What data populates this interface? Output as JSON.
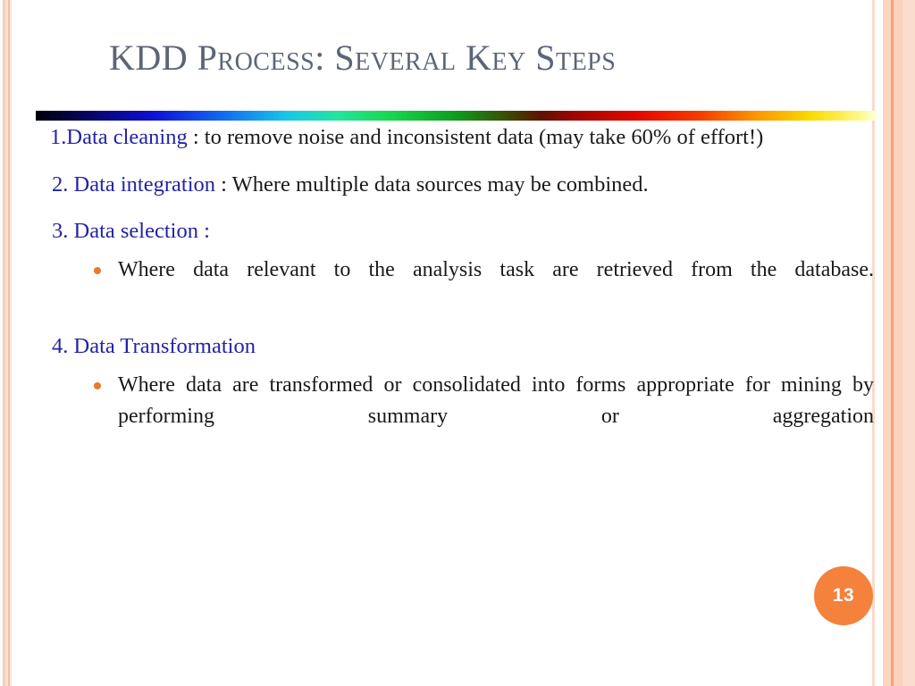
{
  "slide": {
    "title": "KDD Process: Several Key Steps",
    "page_number": "13",
    "colors": {
      "title": "#5c6577",
      "lead_blue": "#2323a6",
      "body_text": "#1a1a1a",
      "bullet_orange": "#e8792e",
      "badge_orange": "#f4823c",
      "edge_peach": "#fbd5c0"
    }
  },
  "items": [
    {
      "lead": "1.Data cleaning",
      "rest": " : to remove noise and inconsistent data (may take 60% of effort!)"
    },
    {
      "lead": "2. Data integration",
      "rest": " : Where multiple data sources may be combined."
    },
    {
      "lead": "3. Data selection :",
      "rest": "",
      "sub": [
        "Where data relevant to the analysis task are retrieved from the database."
      ]
    },
    {
      "lead": "4. Data Transformation",
      "rest": "",
      "sub": [
        "Where data are transformed or consolidated into forms appropriate for mining by performing summary or aggregation"
      ]
    }
  ]
}
